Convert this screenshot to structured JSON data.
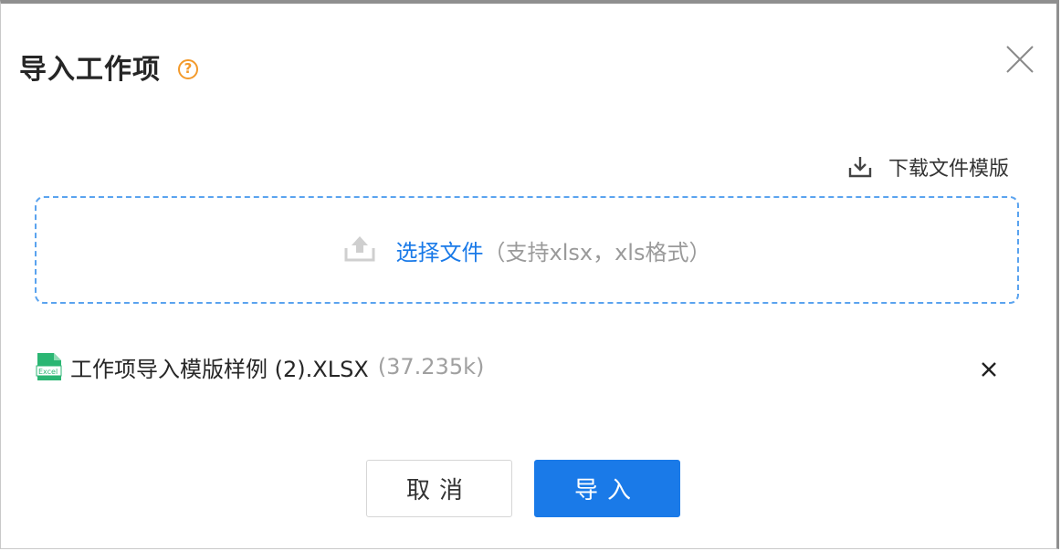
{
  "dialog": {
    "title": "导入工作项",
    "help_symbol": "?"
  },
  "download_template": {
    "label": "下载文件模版"
  },
  "dropzone": {
    "select_label": "选择文件",
    "format_hint": "（支持xlsx，xls格式）"
  },
  "file": {
    "icon_text": "Excel",
    "name": "工作项导入模版样例 (2).XLSX",
    "size": "(37.235k)"
  },
  "buttons": {
    "cancel": "取消",
    "import": "导入"
  },
  "colors": {
    "primary": "#1a7ae8",
    "help": "#f39a2b",
    "excel": "#2bb673"
  }
}
